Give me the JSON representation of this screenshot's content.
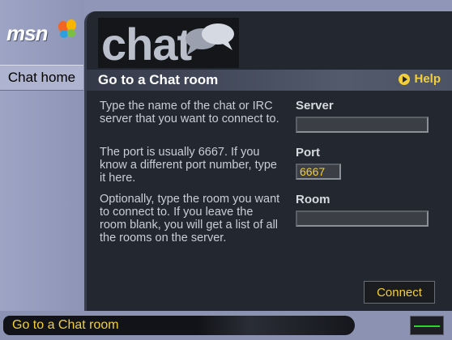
{
  "sidebar": {
    "logo_text": "msn",
    "nav_item": "Chat home"
  },
  "banner": {
    "word": "chat",
    "icon": "speech-bubbles-icon"
  },
  "header": {
    "title": "Go to a Chat room",
    "help_label": "Help"
  },
  "instructions": {
    "server": "Type the name of the chat or IRC server that you want to connect to.",
    "port": "The port is usually 6667. If you know a different port number, type it here.",
    "room": "Optionally, type the room you want to connect to. If you leave the room blank, you will get a list of all the rooms on the server."
  },
  "form": {
    "server_label": "Server",
    "server_value": "",
    "port_label": "Port",
    "port_value": "6667",
    "room_label": "Room",
    "room_value": "",
    "connect_label": "Connect"
  },
  "statusbar": {
    "text": "Go to a Chat room"
  },
  "colors": {
    "accent": "#f2cf3a",
    "panel": "#23272f",
    "chrome": "#8f96b8",
    "indicator": "#2bd62b"
  }
}
